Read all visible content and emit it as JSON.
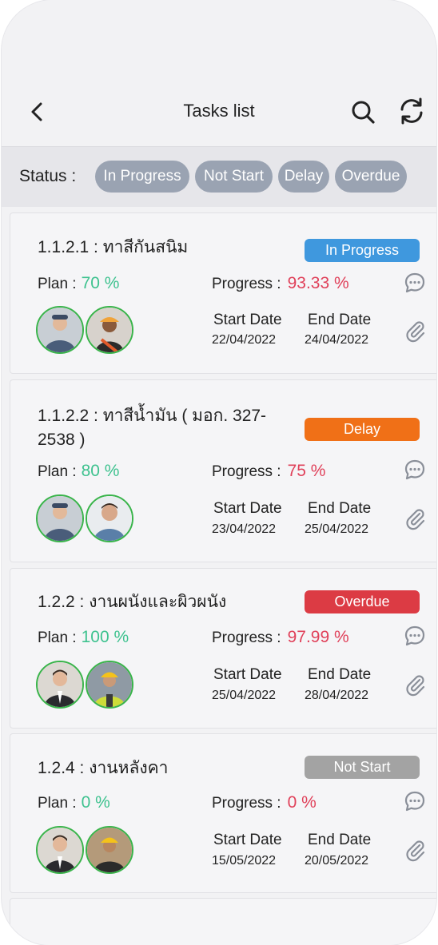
{
  "header": {
    "title": "Tasks list"
  },
  "status_filter": {
    "label": "Status :",
    "chips": [
      "In Progress",
      "Not Start",
      "Delay",
      "Overdue"
    ]
  },
  "labels": {
    "plan": "Plan :",
    "progress": "Progress :",
    "start_date": "Start Date",
    "end_date": "End Date"
  },
  "tasks": [
    {
      "title": "1.1.2.1 : ทาสีกันสนิม",
      "status": "In Progress",
      "status_color": "#3f98de",
      "plan": "70 %",
      "progress": "93.33 %",
      "start": "22/04/2022",
      "end": "24/04/2022"
    },
    {
      "title": "1.1.2.2 : ทาสีน้ำมัน ( มอก. 327-2538 )",
      "status": "Delay",
      "status_color": "#f07017",
      "plan": "80 %",
      "progress": "75 %",
      "start": "23/04/2022",
      "end": "25/04/2022"
    },
    {
      "title": "1.2.2 : งานผนังและผิวผนัง",
      "status": "Overdue",
      "status_color": "#dc3b44",
      "plan": "100 %",
      "progress": "97.99 %",
      "start": "25/04/2022",
      "end": "28/04/2022"
    },
    {
      "title": "1.2.4 : งานหลังคา",
      "status": "Not Start",
      "status_color": "#a3a3a3",
      "plan": "0 %",
      "progress": "0 %",
      "start": "15/05/2022",
      "end": "20/05/2022"
    }
  ]
}
